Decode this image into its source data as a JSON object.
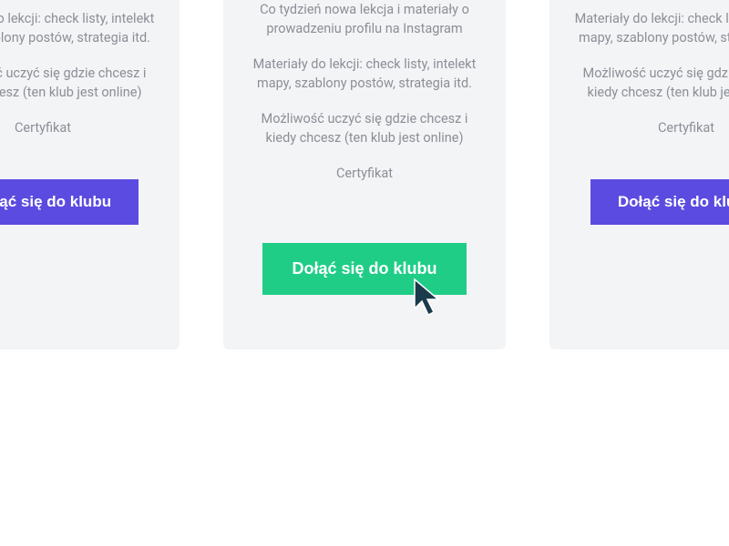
{
  "cta_label": "Dołąć się do klubu",
  "cards": {
    "left": {
      "features": [
        "Materiały do lekcji: check listy, intelekt mapy, szablony postów, strategia itd.",
        "Możliwość uczyć się gdzie chcesz i kiedy chcesz (ten klub jest online)",
        "Certyfikat"
      ]
    },
    "center": {
      "features": [
        "Co tydzień nowa lekcja i materiały o prowadzeniu profilu na Instagram",
        "Materiały do lekcji: check listy, intelekt mapy, szablony postów, strategia itd.",
        "Możliwość uczyć się gdzie chcesz i kiedy chcesz (ten klub jest online)",
        "Certyfikat"
      ]
    },
    "right": {
      "features": [
        "Materiały do lekcji: check listy, intelekt mapy, szablony postów, strategia itd.",
        "Możliwość uczyć się gdzie chcesz i kiedy chcesz (ten klub jest online)",
        "Certyfikat"
      ]
    }
  },
  "colors": {
    "card_bg": "#f3f4f6",
    "text_muted": "#8b8f96",
    "btn_purple": "#5b4be0",
    "btn_green": "#1fcd87",
    "cursor": "#1b3a4b"
  }
}
